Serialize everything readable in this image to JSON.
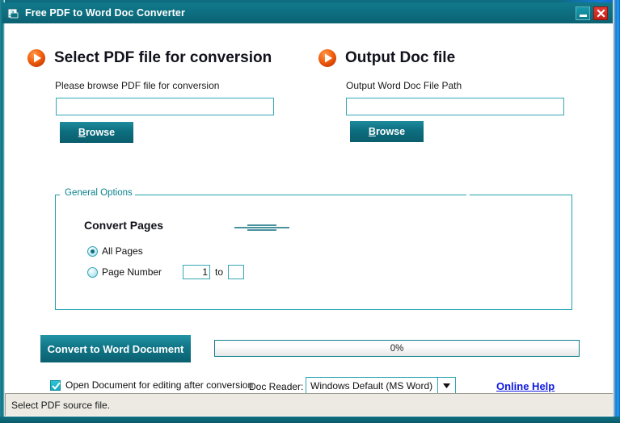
{
  "window": {
    "title": "Free PDF to Word Doc Converter",
    "app_icon": "app-document-icon",
    "minimize_label": "Minimize",
    "close_label": "Close",
    "accent_teal": "#0d6e7f",
    "accent_cyan": "#35a8b5",
    "close_red": "#c32119",
    "link_blue": "#0d18e0"
  },
  "input_section": {
    "icon": "orange-play-bullet-icon",
    "heading": "Select PDF file for conversion",
    "field_label": "Please browse PDF file for conversion",
    "field_value": "",
    "field_placeholder": "",
    "browse_prefix": "B",
    "browse_suffix": "rowse"
  },
  "output_section": {
    "icon": "orange-play-bullet-icon",
    "heading": "Output Doc file",
    "field_label": "Output Word Doc File Path",
    "field_value": "",
    "field_placeholder": "",
    "browse_prefix": "B",
    "browse_suffix": "rowse"
  },
  "general_options": {
    "legend": "General Options",
    "title": "Convert Pages",
    "radios": [
      {
        "label": "All Pages",
        "checked": true
      },
      {
        "label": "Page Number",
        "checked": false
      }
    ],
    "page_from_value": "1",
    "page_to_value": "",
    "to_label": "to"
  },
  "actions": {
    "convert_label": "Convert to Word Document",
    "progress_text": "0%",
    "progress_percent": 0
  },
  "footer": {
    "open_after_label": "Open Document for editing after conversion",
    "open_after_checked": true,
    "doc_reader_label": "Doc Reader:",
    "doc_reader_value": "Windows Default (MS Word)",
    "doc_reader_options": [
      "Windows Default (MS Word)"
    ],
    "help_link": "Online Help"
  },
  "statusbar": {
    "message": "Select PDF source file."
  }
}
